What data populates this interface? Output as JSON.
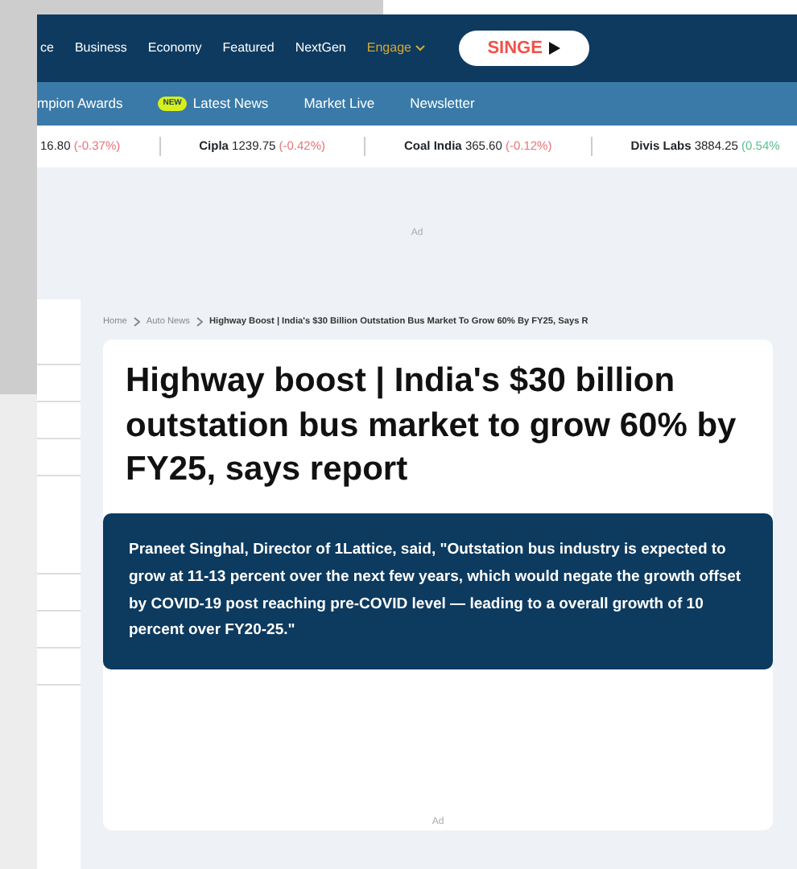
{
  "nav": {
    "items": [
      {
        "label": "ce",
        "kind": "link"
      },
      {
        "label": "Business",
        "kind": "link"
      },
      {
        "label": "Economy",
        "kind": "link"
      },
      {
        "label": "Featured",
        "kind": "link"
      },
      {
        "label": "NextGen",
        "kind": "link"
      },
      {
        "label": "Engage",
        "kind": "dropdown"
      },
      {
        "label": "SINGE",
        "kind": "brand"
      }
    ]
  },
  "subnav": {
    "items": [
      {
        "label": "mpion Awards"
      },
      {
        "label": "Latest News",
        "badge": "NEW"
      },
      {
        "label": "Market Live"
      },
      {
        "label": "Newsletter"
      }
    ]
  },
  "ticker": [
    {
      "price": "16.80",
      "change": "(-0.37%)",
      "kind": "down"
    },
    {
      "name": "Cipla",
      "price": "1239.75",
      "change": "(-0.42%)",
      "kind": "down"
    },
    {
      "name": "Coal India",
      "price": "365.60",
      "change": "(-0.12%)",
      "kind": "down"
    },
    {
      "name": "Divis Labs",
      "price": "3884.25",
      "change": "(0.54%",
      "kind": "up"
    }
  ],
  "ads": [
    "Ad",
    "Ad"
  ],
  "breadcrumb": [
    "Home",
    "Auto News",
    "Highway Boost | India's $30 Billion Outstation Bus Market To Grow 60% By FY25, Says R"
  ],
  "article": {
    "title": "Highway boost | India's $30 billion outstation bus market to grow 60% by FY25, says report",
    "summary": "Praneet Singhal, Director of 1Lattice, said, \"Outstation bus industry is expected to grow at 11-13 percent over the next few years, which would negate the growth offset by COVID-19 post reaching pre-COVID level — leading to a overall growth of 10 percent over FY20-25.\""
  }
}
